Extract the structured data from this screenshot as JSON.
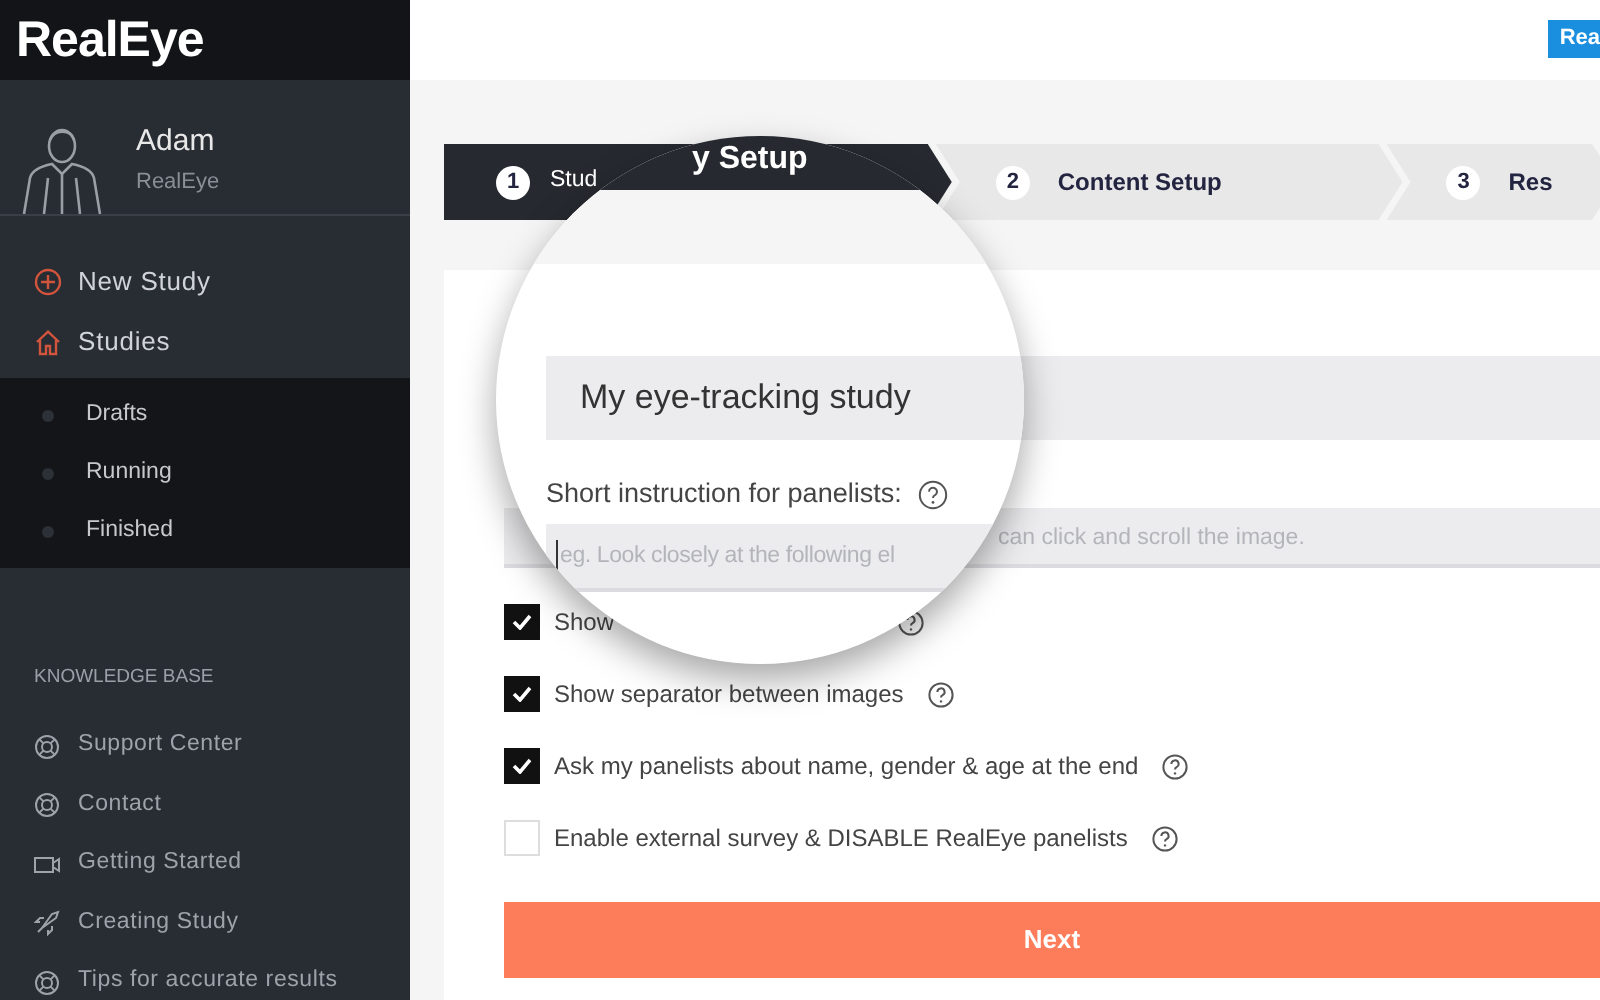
{
  "sidebar": {
    "logo": "RealEye",
    "user": {
      "name": "Adam",
      "organization": "RealEye"
    },
    "menu": [
      {
        "label": "New Study"
      },
      {
        "label": "Studies",
        "children": [
          {
            "label": "Drafts"
          },
          {
            "label": "Running"
          },
          {
            "label": "Finished"
          }
        ]
      }
    ],
    "knowledge_base": {
      "heading": "KNOWLEDGE BASE",
      "items": [
        {
          "label": "Support Center"
        },
        {
          "label": "Contact"
        },
        {
          "label": "Getting Started"
        },
        {
          "label": "Creating Study"
        },
        {
          "label": "Tips for accurate results"
        }
      ]
    }
  },
  "top_button": "Rea",
  "steps": [
    {
      "number": "1",
      "label": "Stud",
      "selected": true
    },
    {
      "number": "2",
      "label": "Content Setup",
      "selected": false
    },
    {
      "number": "3",
      "label": "Res",
      "selected": false
    }
  ],
  "form": {
    "instruction_placeholder": "can click and scroll the image.",
    "options": [
      {
        "label": "Show",
        "checked": true
      },
      {
        "label": "Show separator between images",
        "checked": true
      },
      {
        "label": "Ask my panelists about name, gender & age at the end",
        "checked": true
      },
      {
        "label": "Enable external survey & DISABLE RealEye panelists",
        "checked": false
      }
    ],
    "submit": "Next"
  },
  "magnifier": {
    "step_label": "y Setup",
    "study_name": "My eye-tracking study",
    "instruction_label": "Short instruction for panelists:",
    "instruction_placeholder": "eg. Look closely at the following el"
  }
}
